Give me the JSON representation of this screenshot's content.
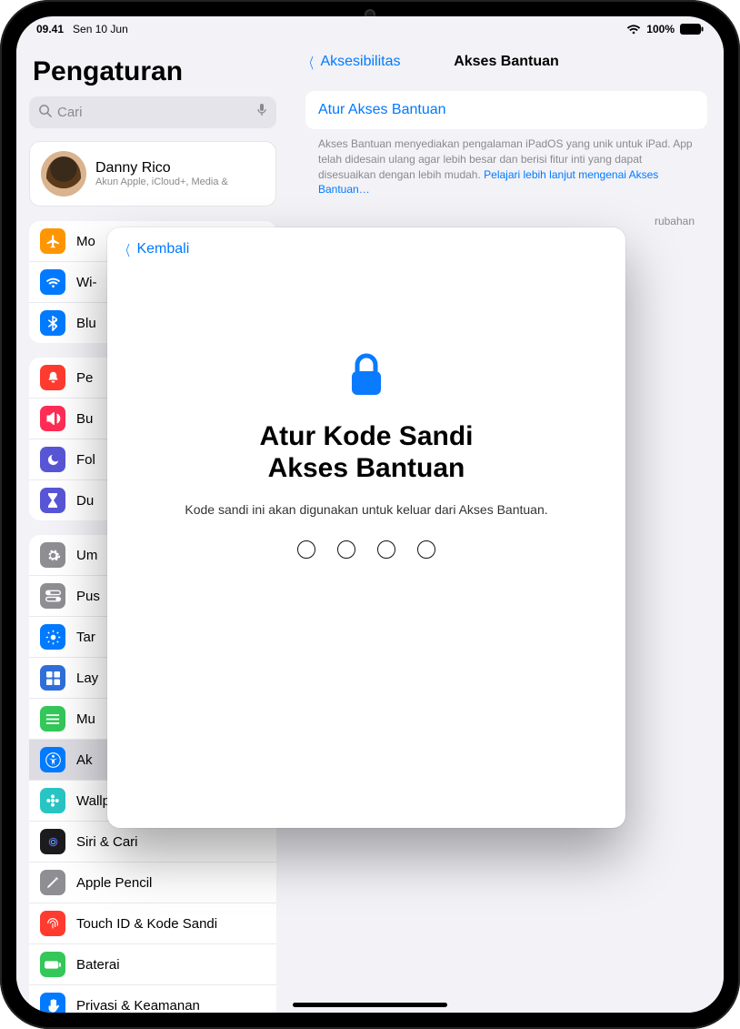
{
  "statusbar": {
    "time": "09.41",
    "date": "Sen 10 Jun",
    "battery": "100%"
  },
  "sidebar": {
    "title": "Pengaturan",
    "search_placeholder": "Cari",
    "account": {
      "name": "Danny Rico",
      "subtitle": "Akun Apple, iCloud+, Media &"
    }
  },
  "groups": [
    {
      "items": [
        {
          "label": "Mo",
          "icon": "airplane",
          "color": "#ff9500"
        },
        {
          "label": "Wi-",
          "icon": "wifi",
          "color": "#007aff"
        },
        {
          "label": "Blu",
          "icon": "bluetooth",
          "color": "#007aff"
        }
      ]
    },
    {
      "items": [
        {
          "label": "Pe",
          "icon": "bell",
          "color": "#ff3b30"
        },
        {
          "label": "Bu",
          "icon": "speaker",
          "color": "#ff2d55"
        },
        {
          "label": "Fol",
          "icon": "moon",
          "color": "#5856d6"
        },
        {
          "label": "Du",
          "icon": "hourglass",
          "color": "#5856d6"
        }
      ]
    },
    {
      "items": [
        {
          "label": "Um",
          "icon": "gear",
          "color": "#8e8e93"
        },
        {
          "label": "Pus",
          "icon": "switches",
          "color": "#8e8e93"
        },
        {
          "label": "Tar",
          "icon": "sun",
          "color": "#007aff"
        },
        {
          "label": "Lay",
          "icon": "grid",
          "color": "#2f6fdb"
        },
        {
          "label": "Mu",
          "icon": "list",
          "color": "#34c759"
        },
        {
          "label": "Ak",
          "icon": "accessibility",
          "color": "#007aff",
          "selected": true
        },
        {
          "label": "Wallpaper",
          "icon": "flower",
          "color": "#29c5c5"
        },
        {
          "label": "Siri & Cari",
          "icon": "siri",
          "color": "#1c1c1e"
        },
        {
          "label": "Apple Pencil",
          "icon": "pencil",
          "color": "#8e8e93"
        },
        {
          "label": "Touch ID & Kode Sandi",
          "icon": "touchid",
          "color": "#ff3b30"
        },
        {
          "label": "Baterai",
          "icon": "battery",
          "color": "#34c759"
        },
        {
          "label": "Privasi & Keamanan",
          "icon": "hand",
          "color": "#007aff"
        }
      ]
    }
  ],
  "main": {
    "back": "Aksesibilitas",
    "title": "Akses Bantuan",
    "card": "Atur Akses Bantuan",
    "desc1": "Akses Bantuan menyediakan pengalaman iPadOS yang unik untuk iPad. App telah didesain ulang agar lebih besar dan berisi fitur inti yang dapat disesuaikan dengan lebih mudah. ",
    "learn_more": "Pelajari lebih lanjut mengenai Akses Bantuan…",
    "desc2_fragment": "rubahan"
  },
  "modal": {
    "back": "Kembali",
    "heading_line1": "Atur Kode Sandi",
    "heading_line2": "Akses Bantuan",
    "subtitle": "Kode sandi ini akan digunakan untuk keluar dari Akses Bantuan."
  }
}
